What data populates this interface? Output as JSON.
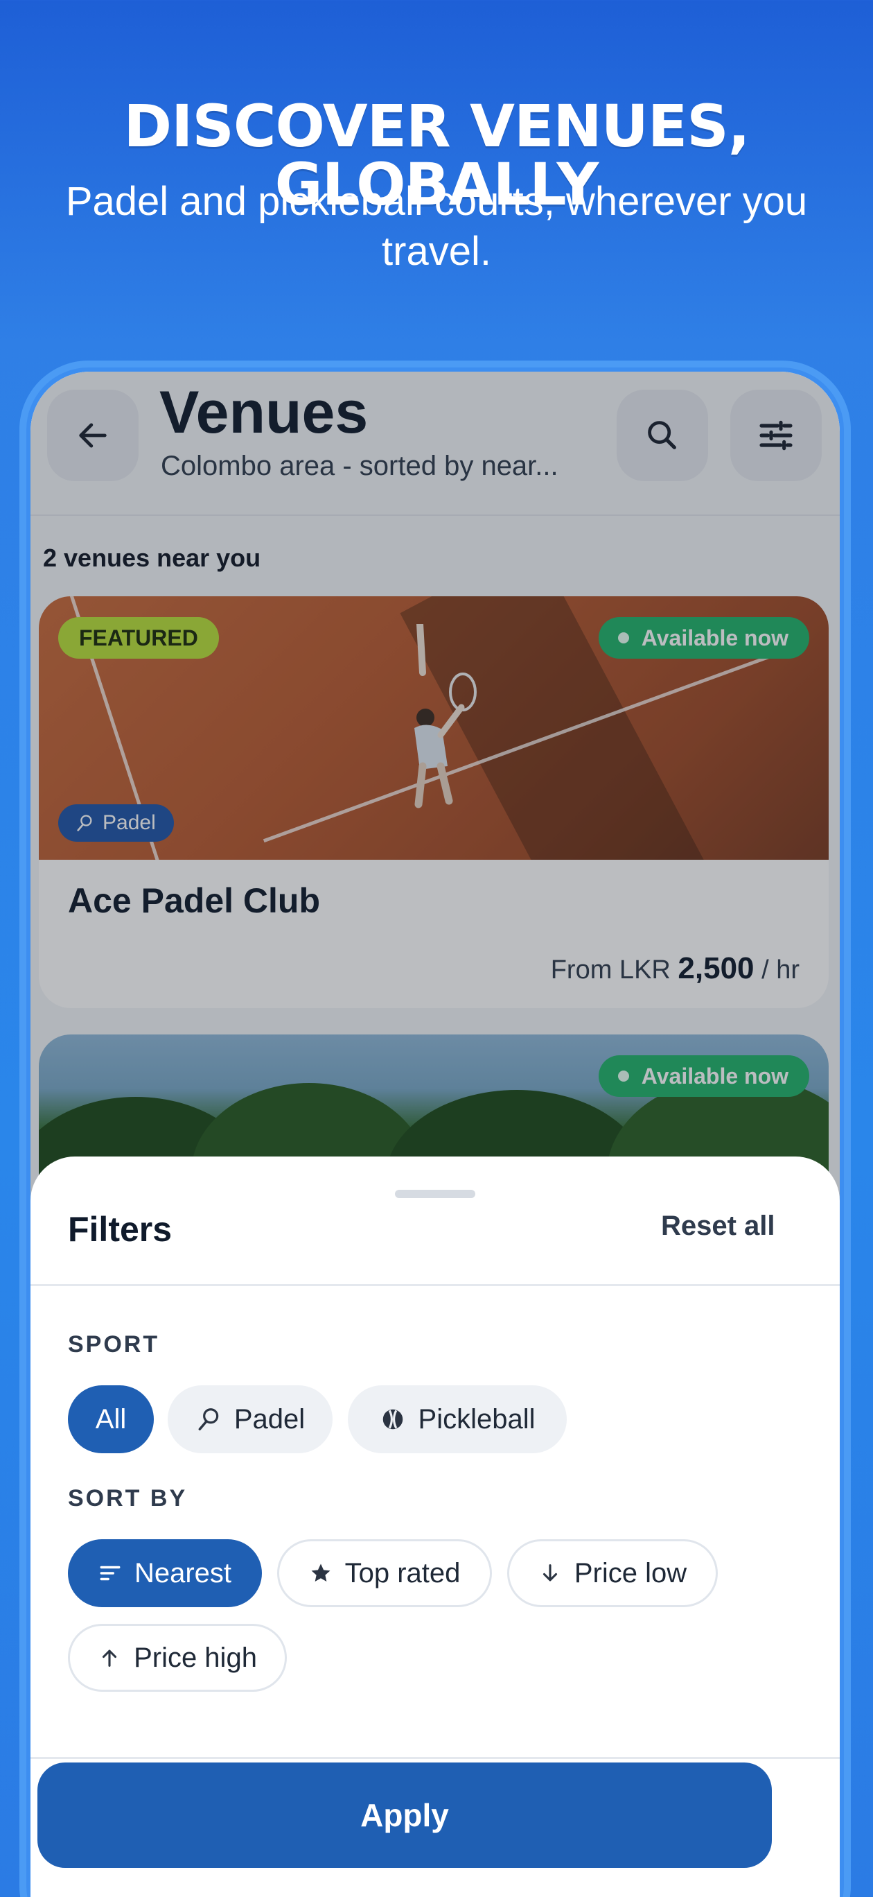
{
  "hero": {
    "title": "DISCOVER VENUES, GLOBALLY",
    "subtitle": "Padel and pickleball courts, wherever you travel."
  },
  "header": {
    "title": "Venues",
    "subtitle": "Colombo area - sorted by near...",
    "icons": [
      "arrow-left-icon",
      "search-icon",
      "sliders-icon"
    ]
  },
  "list": {
    "count_label": "2 venues near you",
    "cards": [
      {
        "featured_label": "FEATURED",
        "availability": "Available now",
        "sport": "Padel",
        "name": "Ace Padel Club",
        "price_prefix": "From LKR",
        "price_value": "2,500",
        "price_suffix": "/ hr"
      },
      {
        "availability": "Available now"
      }
    ]
  },
  "filters": {
    "title": "Filters",
    "reset_label": "Reset all",
    "sport_label": "SPORT",
    "sport_options": [
      {
        "label": "All",
        "active": true
      },
      {
        "label": "Padel",
        "icon": "padel-racket-icon"
      },
      {
        "label": "Pickleball",
        "icon": "pickleball-icon"
      }
    ],
    "sort_label": "SORT BY",
    "sort_options": [
      {
        "label": "Nearest",
        "icon": "sort-lines-icon",
        "active": true
      },
      {
        "label": "Top rated",
        "icon": "star-icon"
      },
      {
        "label": "Price low",
        "icon": "arrow-down-icon"
      },
      {
        "label": "Price high",
        "icon": "arrow-up-icon"
      }
    ],
    "apply_label": "Apply"
  },
  "colors": {
    "primary": "#1f5fb3",
    "featured": "#b9e03a",
    "available": "#22b46a"
  }
}
